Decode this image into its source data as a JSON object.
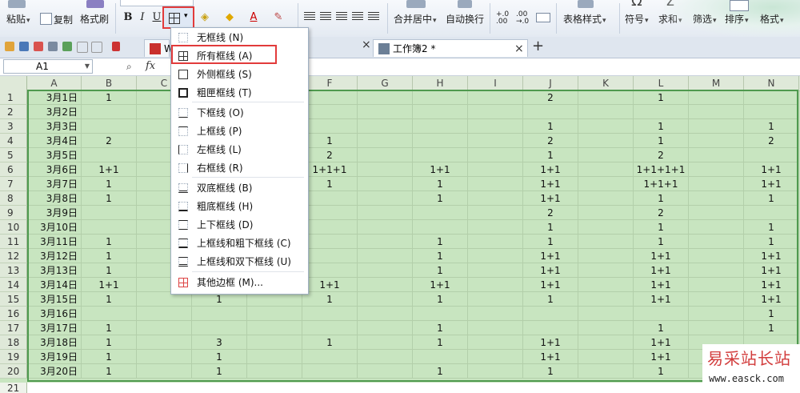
{
  "ribbon": {
    "paste_label": "粘贴",
    "copy_label": "复制",
    "format_painter_label": "格式刷",
    "bold": "B",
    "italic": "I",
    "underline": "U",
    "merge_center_label": "合并居中",
    "wrap_text_label": "自动换行",
    "table_style_label": "表格样式",
    "symbol_label": "符号",
    "sum_label": "求和",
    "filter_label": "筛选",
    "sort_label": "排序",
    "format_label": "格式",
    "sigma_glyph": "Σ",
    "omega_glyph": "Ω",
    "font_color_glyph": "A",
    "dec_increase": "+.0 .00",
    "dec_decrease": ".00 →.0"
  },
  "tabs": [
    {
      "label": "W 我",
      "icon": "wps-logo-icon"
    },
    {
      "label": "工作簿2 *",
      "icon": "spreadsheet-icon"
    }
  ],
  "formula_bar": {
    "name_box": "A1",
    "fx": "fx",
    "zoom_icon": "magnifier-icon"
  },
  "columns": [
    "A",
    "B",
    "C",
    "D",
    "E",
    "F",
    "G",
    "H",
    "I",
    "J",
    "K",
    "L",
    "M",
    "N"
  ],
  "rows": [
    {
      "n": "1",
      "A": "3月1日",
      "B": "1",
      "J": "2",
      "L": "1"
    },
    {
      "n": "2",
      "A": "3月2日"
    },
    {
      "n": "3",
      "A": "3月3日",
      "J": "1",
      "L": "1",
      "N": "1"
    },
    {
      "n": "4",
      "A": "3月4日",
      "B": "2",
      "F": "1",
      "J": "2",
      "L": "1",
      "N": "2"
    },
    {
      "n": "5",
      "A": "3月5日",
      "F": "2",
      "J": "1",
      "L": "2"
    },
    {
      "n": "6",
      "A": "3月6日",
      "B": "1+1",
      "F": "1+1+1",
      "H": "1+1",
      "J": "1+1",
      "L": "1+1+1+1",
      "N": "1+1"
    },
    {
      "n": "7",
      "A": "3月7日",
      "B": "1",
      "F": "1",
      "H": "1",
      "J": "1+1",
      "L": "1+1+1",
      "N": "1+1"
    },
    {
      "n": "8",
      "A": "3月8日",
      "B": "1",
      "H": "1",
      "J": "1+1",
      "L": "1",
      "N": "1"
    },
    {
      "n": "9",
      "A": "3月9日",
      "J": "2",
      "L": "2"
    },
    {
      "n": "10",
      "A": "3月10日",
      "J": "1",
      "L": "1",
      "N": "1"
    },
    {
      "n": "11",
      "A": "3月11日",
      "B": "1",
      "H": "1",
      "J": "1",
      "L": "1",
      "N": "1"
    },
    {
      "n": "12",
      "A": "3月12日",
      "B": "1",
      "H": "1",
      "J": "1+1",
      "L": "1+1",
      "N": "1+1"
    },
    {
      "n": "13",
      "A": "3月13日",
      "B": "1",
      "H": "1",
      "J": "1+1",
      "L": "1+1",
      "N": "1+1"
    },
    {
      "n": "14",
      "A": "3月14日",
      "B": "1+1",
      "F": "1+1",
      "H": "1+1",
      "J": "1+1",
      "L": "1+1",
      "N": "1+1"
    },
    {
      "n": "15",
      "A": "3月15日",
      "B": "1",
      "D": "1",
      "F": "1",
      "H": "1",
      "J": "1",
      "L": "1+1",
      "N": "1+1"
    },
    {
      "n": "16",
      "A": "3月16日",
      "N": "1"
    },
    {
      "n": "17",
      "A": "3月17日",
      "B": "1",
      "H": "1",
      "L": "1",
      "N": "1"
    },
    {
      "n": "18",
      "A": "3月18日",
      "B": "1",
      "D": "3",
      "F": "1",
      "H": "1",
      "J": "1+1",
      "L": "1+1"
    },
    {
      "n": "19",
      "A": "3月19日",
      "B": "1",
      "D": "1",
      "J": "1+1",
      "L": "1+1"
    },
    {
      "n": "20",
      "A": "3月20日",
      "B": "1",
      "D": "1",
      "H": "1",
      "J": "1",
      "L": "1"
    }
  ],
  "extra_row": "21",
  "border_menu": {
    "items": [
      {
        "label": "无框线 (N)",
        "icon": "no-border-icon",
        "style": "none"
      },
      {
        "label": "所有框线 (A)",
        "icon": "all-borders-icon",
        "style": "all"
      },
      {
        "label": "外侧框线 (S)",
        "icon": "outside-borders-icon",
        "style": "outer"
      },
      {
        "label": "粗匣框线 (T)",
        "icon": "thick-box-border-icon",
        "style": "thick"
      },
      {
        "label": "下框线 (O)",
        "icon": "bottom-border-icon",
        "style": "bottom"
      },
      {
        "label": "上框线 (P)",
        "icon": "top-border-icon",
        "style": "top"
      },
      {
        "label": "左框线 (L)",
        "icon": "left-border-icon",
        "style": "left"
      },
      {
        "label": "右框线 (R)",
        "icon": "right-border-icon",
        "style": "right"
      },
      {
        "label": "双底框线 (B)",
        "icon": "double-bottom-border-icon",
        "style": "dbl-bottom"
      },
      {
        "label": "粗底框线 (H)",
        "icon": "thick-bottom-border-icon",
        "style": "thick-bottom"
      },
      {
        "label": "上下框线 (D)",
        "icon": "top-bottom-border-icon",
        "style": "tb"
      },
      {
        "label": "上框线和粗下框线 (C)",
        "icon": "top-thick-bottom-border-icon",
        "style": "t-thickb"
      },
      {
        "label": "上框线和双下框线 (U)",
        "icon": "top-double-bottom-border-icon",
        "style": "t-dblb"
      },
      {
        "label": "其他边框 (M)...",
        "icon": "more-borders-icon",
        "style": "other"
      }
    ],
    "highlighted": "所有框线 (A)"
  },
  "watermark": {
    "title": "易采站长站",
    "url": "www.easck.com"
  },
  "colors": {
    "highlight_red": "#e23b3b",
    "grid_green": "#c8e5c0",
    "selection_outline": "#4f9a4f"
  }
}
